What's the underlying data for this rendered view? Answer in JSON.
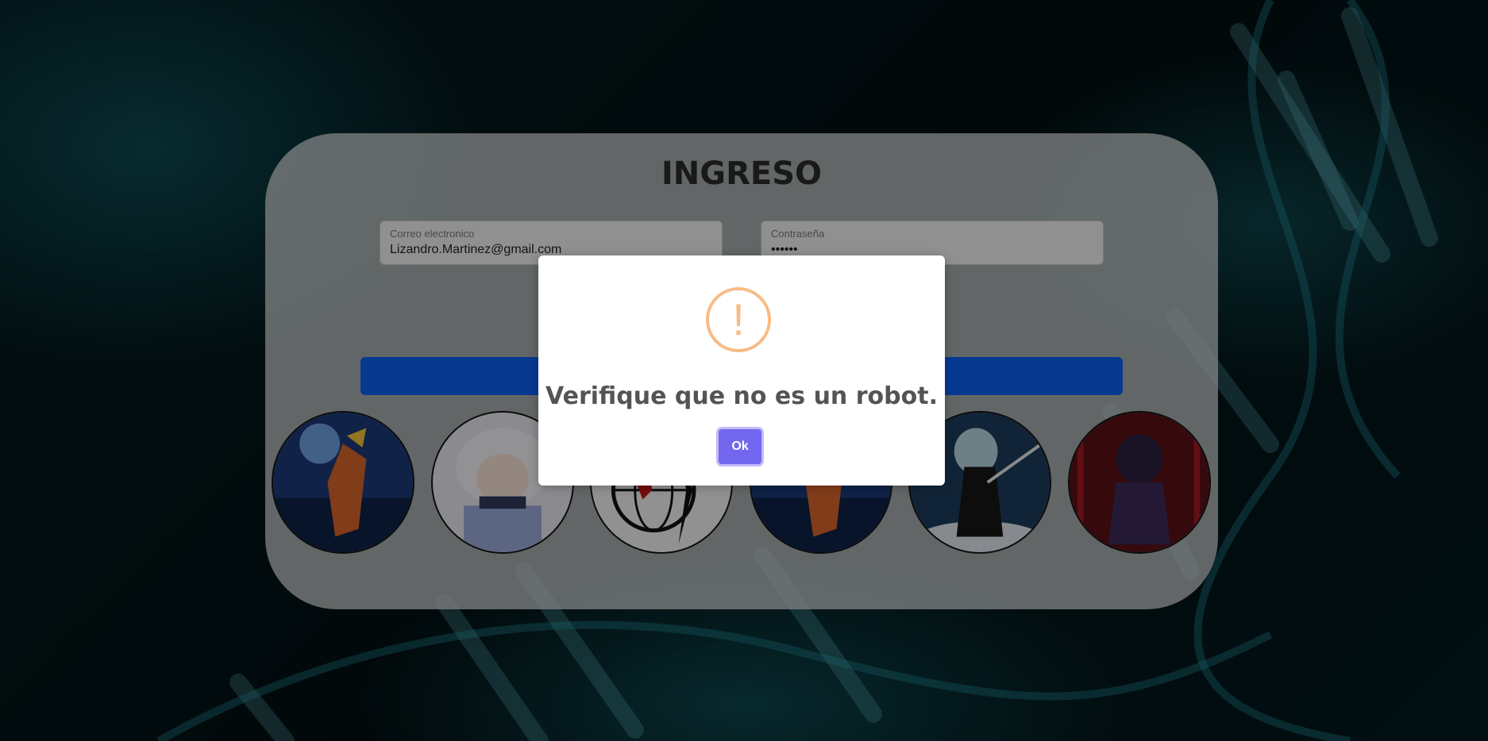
{
  "login": {
    "title": "INGRESO",
    "email_label": "Correo electronico",
    "email_value": "Lizandro.Martinez@gmail.com",
    "password_label": "Contraseña",
    "password_value": "••••••"
  },
  "avatars": [
    {
      "name": "avatar-orange-hair-ninja"
    },
    {
      "name": "avatar-white-hair-boy"
    },
    {
      "name": "avatar-globe-logo"
    },
    {
      "name": "avatar-orange-hair-ninja-2"
    },
    {
      "name": "avatar-silver-hair-swordsman"
    },
    {
      "name": "avatar-dark-red-character"
    }
  ],
  "alert": {
    "icon": "warning-icon",
    "message": "Verifique que no es un robot.",
    "ok_label": "Ok"
  },
  "colors": {
    "submit_bar": "#0d5ff2",
    "ok_button": "#7367f0",
    "warning_icon": "#f8bb86"
  }
}
